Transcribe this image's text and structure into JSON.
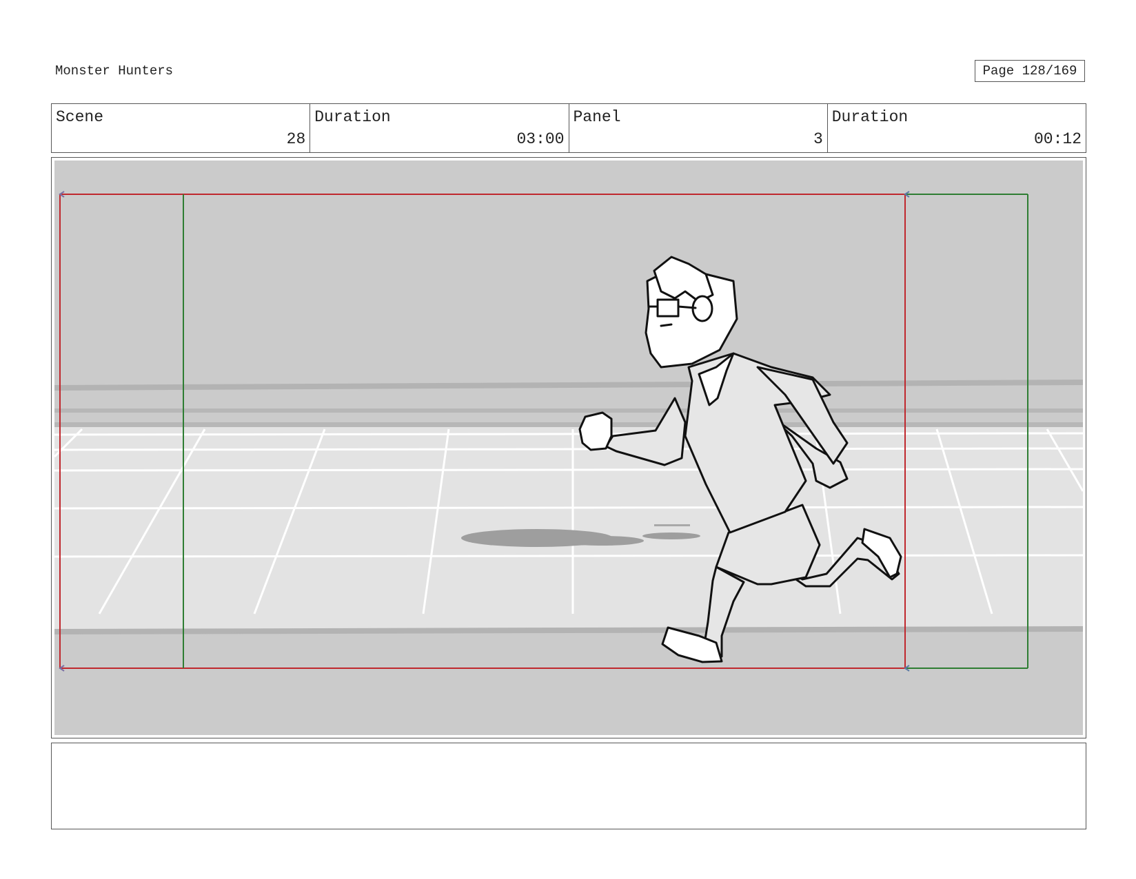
{
  "header": {
    "project_title": "Monster Hunters",
    "page_label": "Page 128/169"
  },
  "info": {
    "scene_label": "Scene",
    "scene_value": "28",
    "scene_duration_label": "Duration",
    "scene_duration_value": "03:00",
    "panel_label": "Panel",
    "panel_value": "3",
    "panel_duration_label": "Duration",
    "panel_duration_value": "00:12"
  },
  "panel": {
    "description": ""
  },
  "notes": {
    "text": ""
  },
  "colors": {
    "frame_red": "#c0272d",
    "frame_green": "#2e7d32",
    "background_gray": "#cbcbcb",
    "floor_gray": "#e3e3e3"
  }
}
